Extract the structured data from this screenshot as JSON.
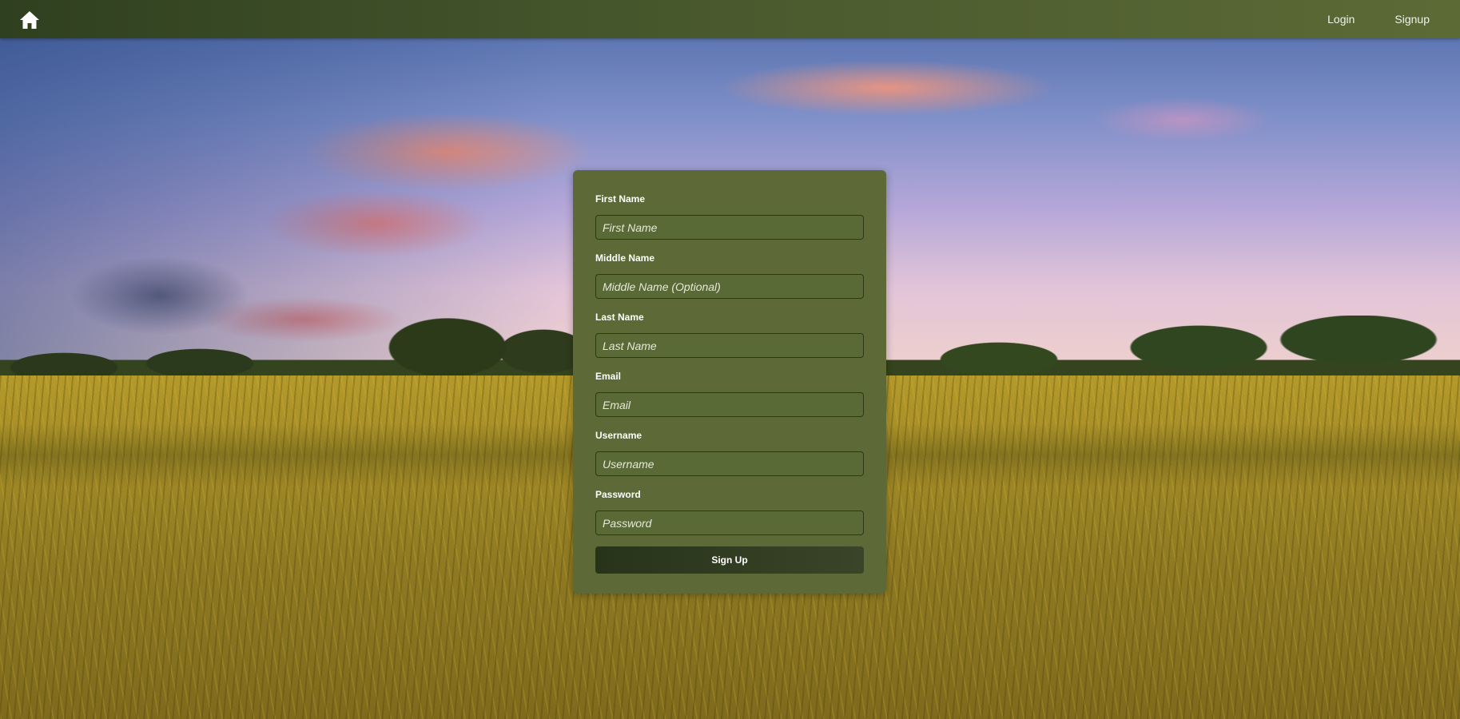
{
  "navbar": {
    "home_icon": "home-icon",
    "links": [
      {
        "label": "Login"
      },
      {
        "label": "Signup"
      }
    ]
  },
  "form": {
    "fields": [
      {
        "label": "First Name",
        "placeholder": "First Name",
        "type": "text"
      },
      {
        "label": "Middle Name",
        "placeholder": "Middle Name (Optional)",
        "type": "text"
      },
      {
        "label": "Last Name",
        "placeholder": "Last Name",
        "type": "text"
      },
      {
        "label": "Email",
        "placeholder": "Email",
        "type": "email"
      },
      {
        "label": "Username",
        "placeholder": "Username",
        "type": "text"
      },
      {
        "label": "Password",
        "placeholder": "Password",
        "type": "password"
      }
    ],
    "submit_label": "Sign Up"
  },
  "colors": {
    "navbar": "#4a5a2e",
    "card": "#5d6a37",
    "button": "#2f3b20"
  }
}
